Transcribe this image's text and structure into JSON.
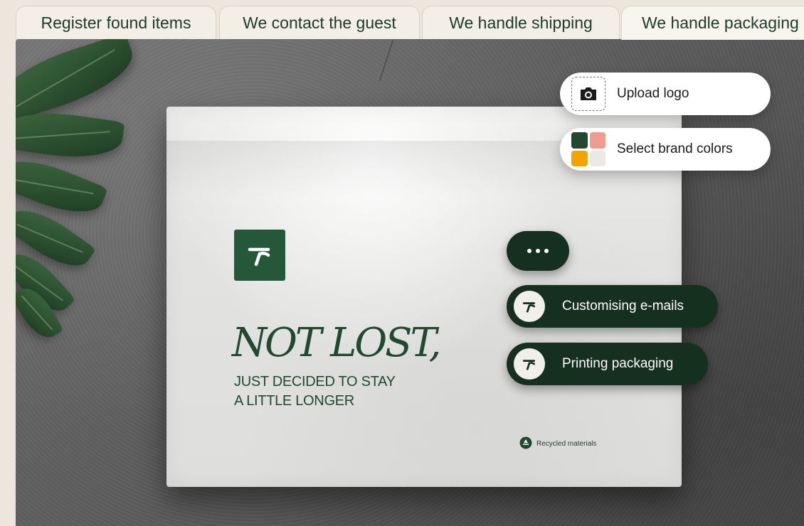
{
  "tabs": [
    {
      "label": "Register found items"
    },
    {
      "label": "We contact the guest"
    },
    {
      "label": "We handle shipping"
    },
    {
      "label": "We handle packaging",
      "active": true
    }
  ],
  "bag": {
    "headline": "NOT LOST,",
    "subline_1": "JUST DECIDED TO STAY",
    "subline_2": "A LITTLE LONGER",
    "recycled_label": "Recycled materials"
  },
  "actions": {
    "upload_logo_label": "Upload logo",
    "select_colors_label": "Select brand colors",
    "customising_emails_label": "Customising e-mails",
    "printing_packaging_label": "Printing packaging"
  },
  "icons": {
    "camera": "camera-icon",
    "swatches": "color-swatch-icon",
    "more": "more-dots-icon",
    "brand": "brand-logo-icon",
    "recycle": "recycle-icon"
  },
  "colors": {
    "brand_green": "#245838",
    "dark_pill": "#16301f",
    "swatch_dark_green": "#1f4a30",
    "swatch_pink": "#f19a8e",
    "swatch_orange": "#f4a400",
    "swatch_light": "#ece8e2"
  }
}
